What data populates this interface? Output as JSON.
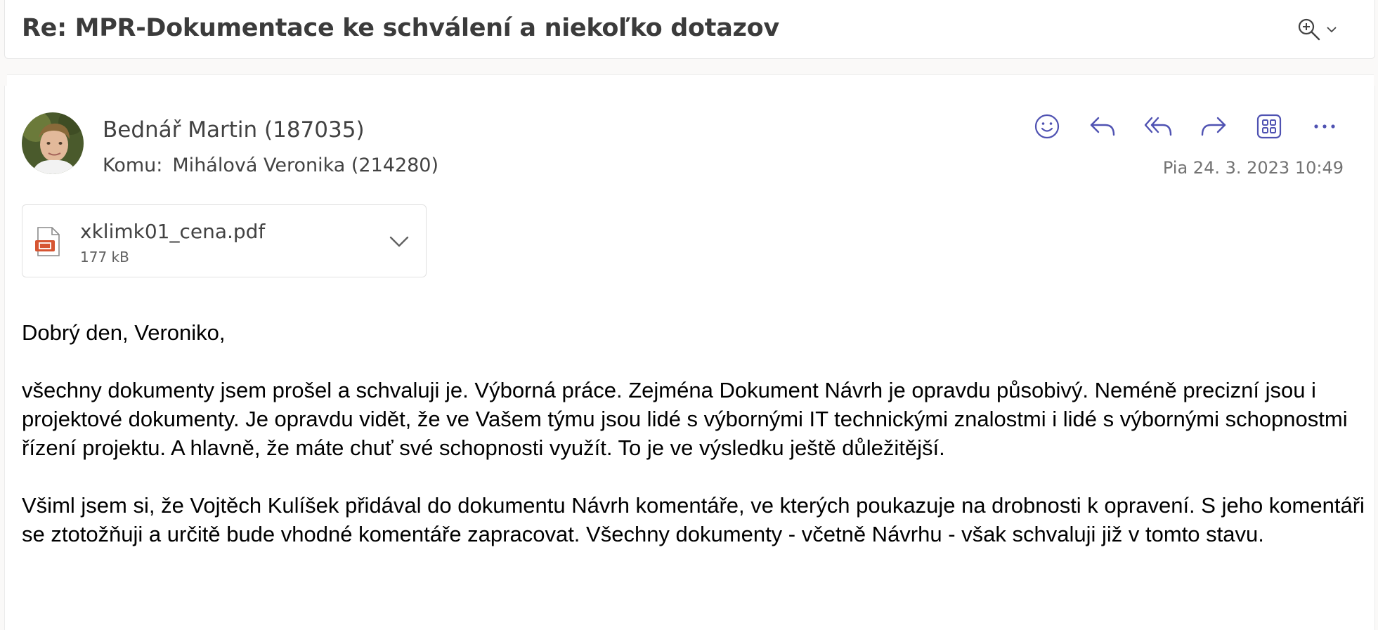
{
  "subject": {
    "title": "Re: MPR-Dokumentace ke schválení a niekoľko dotazov"
  },
  "toolbar": {
    "zoom_icon": "zoom-in-icon",
    "chevron_icon": "chevron-down-icon"
  },
  "message": {
    "sender": "Bednář Martin (187035)",
    "to_label": "Komu:",
    "recipient": "Mihálová Veronika (214280)",
    "timestamp": "Pia 24. 3. 2023 10:49",
    "actions": [
      {
        "name": "emoji-reaction",
        "icon": "smiley-icon"
      },
      {
        "name": "reply",
        "icon": "reply-icon"
      },
      {
        "name": "reply-all",
        "icon": "reply-all-icon"
      },
      {
        "name": "forward",
        "icon": "forward-icon"
      },
      {
        "name": "apps",
        "icon": "apps-icon"
      },
      {
        "name": "more",
        "icon": "more-icon"
      }
    ],
    "accent_color": "#4f52b2"
  },
  "attachment": {
    "file_name": "xklimk01_cena.pdf",
    "file_size": "177 kB",
    "icon": "pdf-file-icon"
  },
  "body": {
    "greeting": "Dobrý den, Veroniko,",
    "paragraphs": [
      "všechny dokumenty jsem prošel a schvaluji je. Výborná práce. Zejména Dokument Návrh je opravdu působivý. Neméně precizní jsou i projektové dokumenty. Je opravdu vidět, že ve Vašem týmu jsou lidé s výbornými IT technickými znalostmi i lidé s výbornými schopnostmi řízení projektu. A hlavně, že máte chuť své schopnosti využít. To je ve výsledku ještě důležitější.",
      "Všiml jsem si, že Vojtěch Kulíšek přidával do dokumentu Návrh komentáře, ve kterých poukazuje na drobnosti k opravení. S jeho komentáři se ztotožňuji a určitě bude vhodné komentáře zapracovat. Všechny dokumenty - včetně Návrhu - však schvaluji již v tomto stavu."
    ]
  }
}
